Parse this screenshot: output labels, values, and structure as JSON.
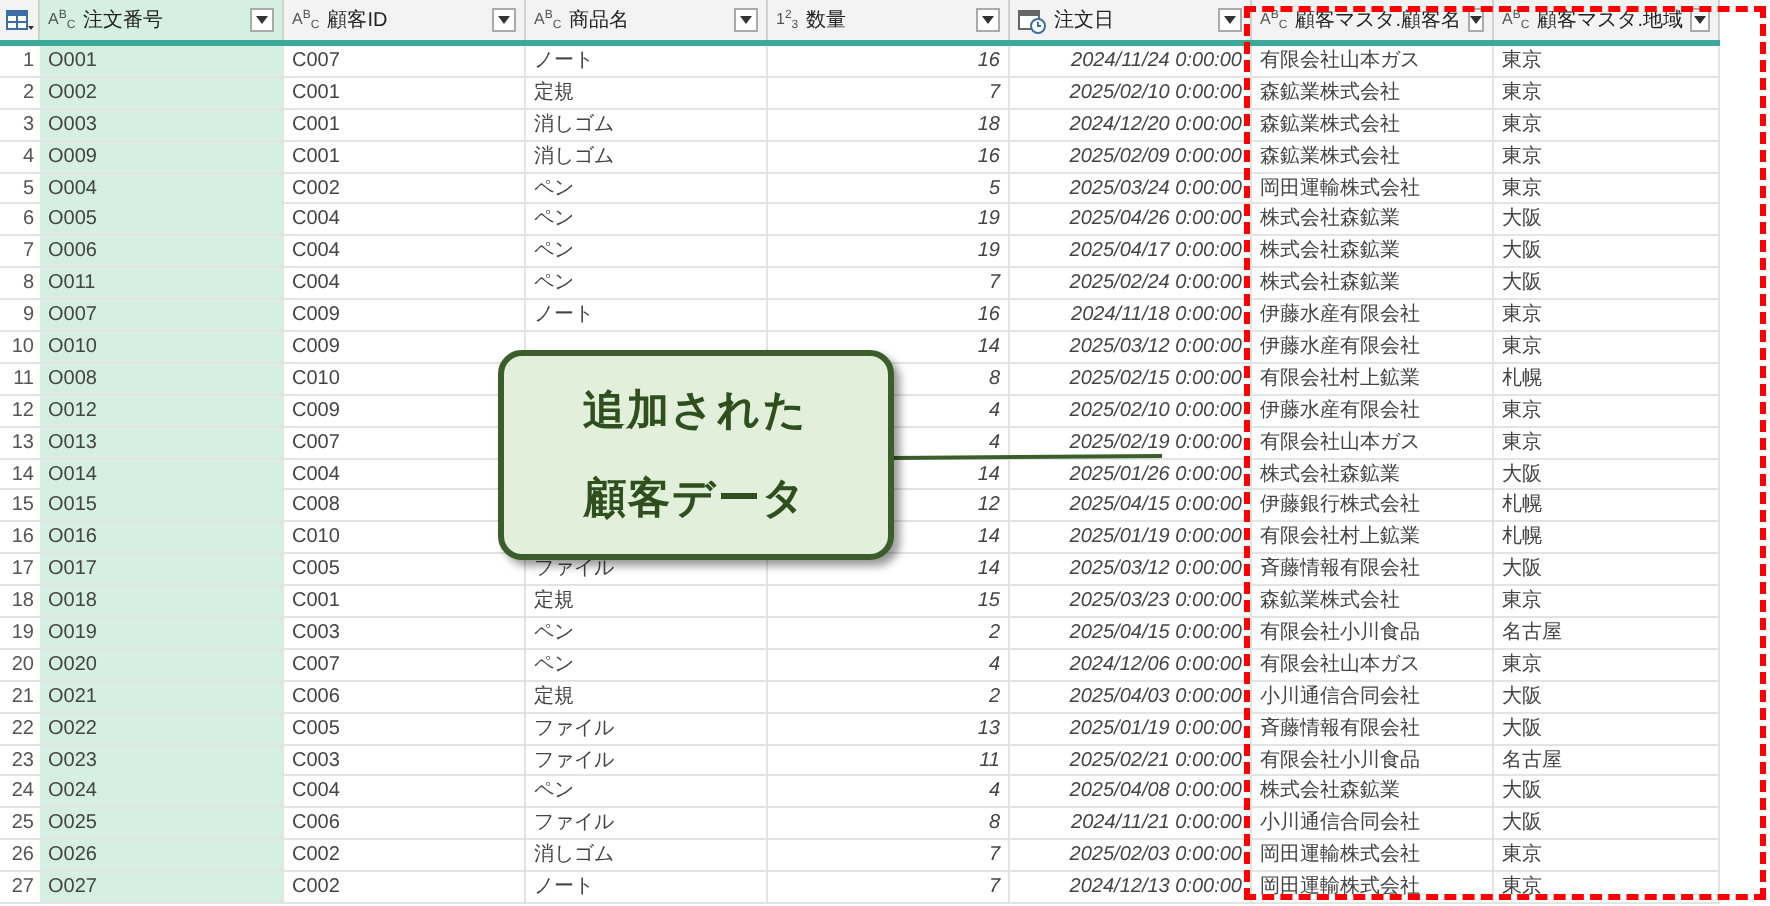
{
  "columns": [
    {
      "name": "注文番号",
      "kind": "text",
      "type_glyph": "A$^{B}$$_{C}$",
      "selected": true
    },
    {
      "name": "顧客ID",
      "kind": "text",
      "type_glyph": "A$^{B}$$_{C}$",
      "selected": false
    },
    {
      "name": "商品名",
      "kind": "text",
      "type_glyph": "A$^{B}$$_{C}$",
      "selected": false
    },
    {
      "name": "数量",
      "kind": "number",
      "type_glyph": "1$^{2}$$_{3}$",
      "selected": false
    },
    {
      "name": "注文日",
      "kind": "date",
      "selected": false
    },
    {
      "name": "顧客マスタ.顧客名",
      "kind": "text",
      "type_glyph": "A$^{B}$$_{C}$",
      "selected": false
    },
    {
      "name": "顧客マスタ.地域",
      "kind": "text",
      "type_glyph": "A$^{B}$$_{C}$",
      "selected": false
    }
  ],
  "rows": [
    {
      "index": "1",
      "cells": [
        "O001",
        "C007",
        "ノート",
        "16",
        "2024/11/24 0:00:00",
        "有限会社山本ガス",
        "東京"
      ]
    },
    {
      "index": "2",
      "cells": [
        "O002",
        "C001",
        "定規",
        "7",
        "2025/02/10 0:00:00",
        "森鉱業株式会社",
        "東京"
      ]
    },
    {
      "index": "3",
      "cells": [
        "O003",
        "C001",
        "消しゴム",
        "18",
        "2024/12/20 0:00:00",
        "森鉱業株式会社",
        "東京"
      ]
    },
    {
      "index": "4",
      "cells": [
        "O009",
        "C001",
        "消しゴム",
        "16",
        "2025/02/09 0:00:00",
        "森鉱業株式会社",
        "東京"
      ]
    },
    {
      "index": "5",
      "cells": [
        "O004",
        "C002",
        "ペン",
        "5",
        "2025/03/24 0:00:00",
        "岡田運輸株式会社",
        "東京"
      ]
    },
    {
      "index": "6",
      "cells": [
        "O005",
        "C004",
        "ペン",
        "19",
        "2025/04/26 0:00:00",
        "株式会社森鉱業",
        "大阪"
      ]
    },
    {
      "index": "7",
      "cells": [
        "O006",
        "C004",
        "ペン",
        "19",
        "2025/04/17 0:00:00",
        "株式会社森鉱業",
        "大阪"
      ]
    },
    {
      "index": "8",
      "cells": [
        "O011",
        "C004",
        "ペン",
        "7",
        "2025/02/24 0:00:00",
        "株式会社森鉱業",
        "大阪"
      ]
    },
    {
      "index": "9",
      "cells": [
        "O007",
        "C009",
        "ノート",
        "16",
        "2024/11/18 0:00:00",
        "伊藤水産有限会社",
        "東京"
      ]
    },
    {
      "index": "10",
      "cells": [
        "O010",
        "C009",
        null,
        "14",
        "2025/03/12 0:00:00",
        "伊藤水産有限会社",
        "東京"
      ]
    },
    {
      "index": "11",
      "cells": [
        "O008",
        "C010",
        null,
        "8",
        "2025/02/15 0:00:00",
        "有限会社村上鉱業",
        "札幌"
      ]
    },
    {
      "index": "12",
      "cells": [
        "O012",
        "C009",
        null,
        "4",
        "2025/02/10 0:00:00",
        "伊藤水産有限会社",
        "東京"
      ]
    },
    {
      "index": "13",
      "cells": [
        "O013",
        "C007",
        null,
        "4",
        "2025/02/19 0:00:00",
        "有限会社山本ガス",
        "東京"
      ]
    },
    {
      "index": "14",
      "cells": [
        "O014",
        "C004",
        null,
        "14",
        "2025/01/26 0:00:00",
        "株式会社森鉱業",
        "大阪"
      ]
    },
    {
      "index": "15",
      "cells": [
        "O015",
        "C008",
        null,
        "12",
        "2025/04/15 0:00:00",
        "伊藤銀行株式会社",
        "札幌"
      ]
    },
    {
      "index": "16",
      "cells": [
        "O016",
        "C010",
        null,
        "14",
        "2025/01/19 0:00:00",
        "有限会社村上鉱業",
        "札幌"
      ]
    },
    {
      "index": "17",
      "cells": [
        "O017",
        "C005",
        "ファイル",
        "14",
        "2025/03/12 0:00:00",
        "斉藤情報有限会社",
        "大阪"
      ]
    },
    {
      "index": "18",
      "cells": [
        "O018",
        "C001",
        "定規",
        "15",
        "2025/03/23 0:00:00",
        "森鉱業株式会社",
        "東京"
      ]
    },
    {
      "index": "19",
      "cells": [
        "O019",
        "C003",
        "ペン",
        "2",
        "2025/04/15 0:00:00",
        "有限会社小川食品",
        "名古屋"
      ]
    },
    {
      "index": "20",
      "cells": [
        "O020",
        "C007",
        "ペン",
        "4",
        "2024/12/06 0:00:00",
        "有限会社山本ガス",
        "東京"
      ]
    },
    {
      "index": "21",
      "cells": [
        "O021",
        "C006",
        "定規",
        "2",
        "2025/04/03 0:00:00",
        "小川通信合同会社",
        "大阪"
      ]
    },
    {
      "index": "22",
      "cells": [
        "O022",
        "C005",
        "ファイル",
        "13",
        "2025/01/19 0:00:00",
        "斉藤情報有限会社",
        "大阪"
      ]
    },
    {
      "index": "23",
      "cells": [
        "O023",
        "C003",
        "ファイル",
        "11",
        "2025/02/21 0:00:00",
        "有限会社小川食品",
        "名古屋"
      ]
    },
    {
      "index": "24",
      "cells": [
        "O024",
        "C004",
        "ペン",
        "4",
        "2025/04/08 0:00:00",
        "株式会社森鉱業",
        "大阪"
      ]
    },
    {
      "index": "25",
      "cells": [
        "O025",
        "C006",
        "ファイル",
        "8",
        "2024/11/21 0:00:00",
        "小川通信合同会社",
        "大阪"
      ]
    },
    {
      "index": "26",
      "cells": [
        "O026",
        "C002",
        "消しゴム",
        "7",
        "2025/02/03 0:00:00",
        "岡田運輸株式会社",
        "東京"
      ]
    },
    {
      "index": "27",
      "cells": [
        "O027",
        "C002",
        "ノート",
        "7",
        "2024/12/13 0:00:00",
        "岡田運輸株式会社",
        "東京"
      ]
    }
  ],
  "callout": {
    "lines": [
      "追加された",
      "顧客データ"
    ]
  },
  "highlight": {
    "shown": true
  }
}
